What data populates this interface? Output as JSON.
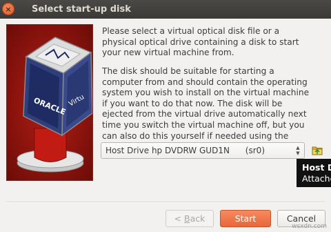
{
  "window": {
    "title": "Select start-up disk",
    "close_glyph": "×"
  },
  "logo": {
    "brand_text": "ORACLE",
    "product_text": "Virtu"
  },
  "message": {
    "paragraph1": "Please select a virtual optical disk file or a physical optical drive containing a disk to start your new virtual machine from.",
    "paragraph2": "The disk should be suitable for starting a computer from and should contain the operating system you wish to install on the virtual machine if you want to do that now. The disk will be ejected from the virtual drive automatically next time you switch the virtual machine off, but you can also do this yourself if needed using the Devices menu."
  },
  "disk_selector": {
    "selected_value": "Host Drive hp DVDRW GUD1N      (sr0)"
  },
  "tooltip": {
    "title": "Host Dr",
    "subtitle": "Attache"
  },
  "buttons": {
    "back_prefix": "< ",
    "back_mnemonic": "B",
    "back_rest": "ack",
    "start": "Start",
    "cancel": "Cancel"
  },
  "watermark": "wsxdn.com",
  "colors": {
    "accent": "#e8663a",
    "titlebar": "#3c3b37",
    "logo_bg": "#9a1610"
  },
  "icons": {
    "close": "close-icon",
    "browse": "folder-browse-icon",
    "combo": "combo-arrows-icon"
  }
}
